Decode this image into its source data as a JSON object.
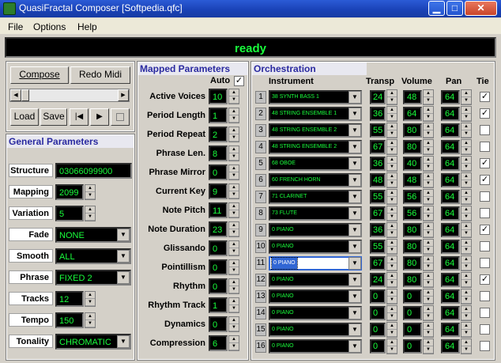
{
  "window": {
    "title": "QuasiFractal Composer [Softpedia.qfc]",
    "min": "▁",
    "max": "□",
    "close": "✕"
  },
  "menu": [
    "File",
    "Options",
    "Help"
  ],
  "status": "ready",
  "transport": {
    "compose": "Compose",
    "redo": "Redo Midi",
    "load": "Load",
    "save": "Save",
    "prev": "|◀",
    "play": "▶"
  },
  "general": {
    "header": "General Parameters",
    "params": [
      {
        "label": "Structure",
        "value": "03066099900",
        "kind": "text"
      },
      {
        "label": "Mapping",
        "value": "2099",
        "kind": "spin"
      },
      {
        "label": "Variation",
        "value": "5",
        "kind": "spin"
      },
      {
        "label": "Fade",
        "value": "NONE",
        "kind": "drop"
      },
      {
        "label": "Smooth",
        "value": "ALL",
        "kind": "drop"
      },
      {
        "label": "Phrase",
        "value": "FIXED 2",
        "kind": "drop"
      },
      {
        "label": "Tracks",
        "value": "12",
        "kind": "spin"
      },
      {
        "label": "Tempo",
        "value": "150",
        "kind": "spin"
      },
      {
        "label": "Tonality",
        "value": "CHROMATIC",
        "kind": "drop"
      }
    ]
  },
  "mapped": {
    "header": "Mapped Parameters",
    "auto_label": "Auto",
    "auto_checked": "✓",
    "params": [
      {
        "label": "Active Voices",
        "value": "10"
      },
      {
        "label": "Period Length",
        "value": "1"
      },
      {
        "label": "Period Repeat",
        "value": "2"
      },
      {
        "label": "Phrase Len.",
        "value": "8"
      },
      {
        "label": "Phrase Mirror",
        "value": "0"
      },
      {
        "label": "Current Key",
        "value": "9"
      },
      {
        "label": "Note Pitch",
        "value": "11"
      },
      {
        "label": "Note Duration",
        "value": "23"
      },
      {
        "label": "Glissando",
        "value": "0"
      },
      {
        "label": "Pointillism",
        "value": "0"
      },
      {
        "label": "Rhythm",
        "value": "0"
      },
      {
        "label": "Rhythm Track",
        "value": "1"
      },
      {
        "label": "Dynamics",
        "value": "0"
      },
      {
        "label": "Compression",
        "value": "6"
      }
    ]
  },
  "orch": {
    "header": "Orchestration",
    "cols": {
      "inst": "Instrument",
      "transp": "Transp",
      "vol": "Volume",
      "pan": "Pan",
      "tie": "Tie"
    },
    "rows": [
      {
        "n": "1",
        "inst": "38 SYNTH BASS 1",
        "t": "24",
        "v": "48",
        "p": "64",
        "tie": "✓"
      },
      {
        "n": "2",
        "inst": "48 STRING ENSEMBLE 1",
        "t": "36",
        "v": "64",
        "p": "64",
        "tie": "✓"
      },
      {
        "n": "3",
        "inst": "48 STRING ENSEMBLE 2",
        "t": "55",
        "v": "80",
        "p": "64",
        "tie": ""
      },
      {
        "n": "4",
        "inst": "48 STRING ENSEMBLE 2",
        "t": "67",
        "v": "80",
        "p": "64",
        "tie": ""
      },
      {
        "n": "5",
        "inst": "68 OBOE",
        "t": "36",
        "v": "40",
        "p": "64",
        "tie": "✓"
      },
      {
        "n": "6",
        "inst": "60 FRENCH HORN",
        "t": "48",
        "v": "48",
        "p": "64",
        "tie": "✓"
      },
      {
        "n": "7",
        "inst": "71 CLARINET",
        "t": "55",
        "v": "56",
        "p": "64",
        "tie": ""
      },
      {
        "n": "8",
        "inst": "73 FLUTE",
        "t": "67",
        "v": "56",
        "p": "64",
        "tie": ""
      },
      {
        "n": "9",
        "inst": "0 PIANO",
        "t": "36",
        "v": "80",
        "p": "64",
        "tie": "✓"
      },
      {
        "n": "10",
        "inst": "0 PIANO",
        "t": "55",
        "v": "80",
        "p": "64",
        "tie": ""
      },
      {
        "n": "11",
        "inst": "0 PIANO",
        "t": "67",
        "v": "80",
        "p": "64",
        "tie": ""
      },
      {
        "n": "12",
        "inst": "0 PIANO",
        "t": "24",
        "v": "80",
        "p": "64",
        "tie": "✓"
      },
      {
        "n": "13",
        "inst": "0 PIANO",
        "t": "0",
        "v": "0",
        "p": "64",
        "tie": ""
      },
      {
        "n": "14",
        "inst": "0 PIANO",
        "t": "0",
        "v": "0",
        "p": "64",
        "tie": ""
      },
      {
        "n": "15",
        "inst": "0 PIANO",
        "t": "0",
        "v": "0",
        "p": "64",
        "tie": ""
      },
      {
        "n": "16",
        "inst": "0 PIANO",
        "t": "0",
        "v": "0",
        "p": "64",
        "tie": ""
      }
    ]
  }
}
